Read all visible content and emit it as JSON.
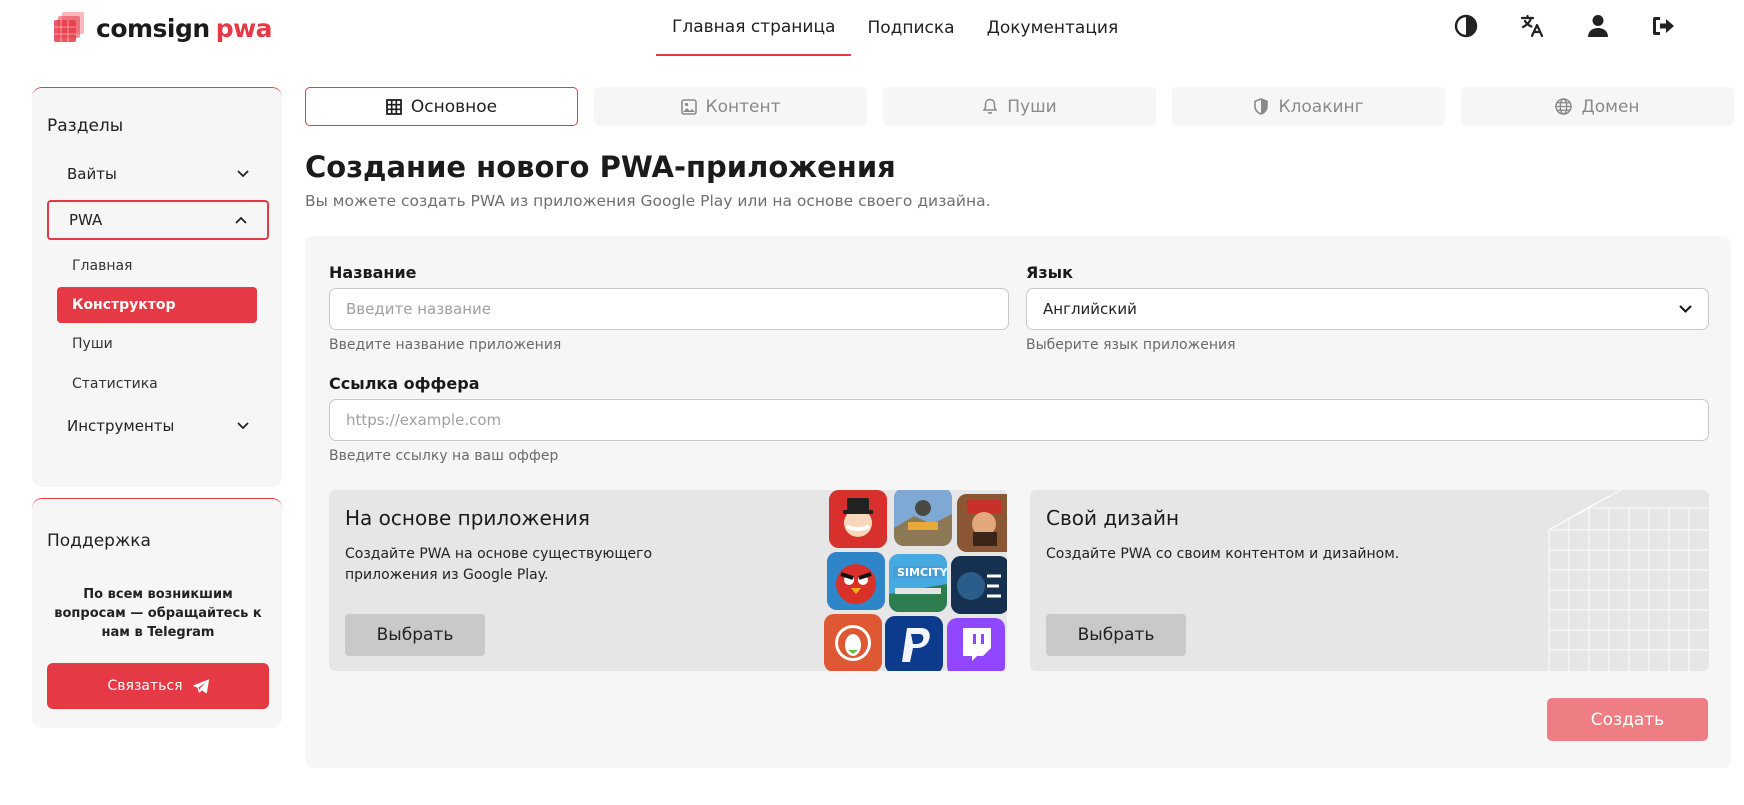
{
  "brand": {
    "name_part1": "comsign",
    "name_part2": "pwa",
    "accent": "#e63946"
  },
  "topnav": {
    "items": [
      {
        "label": "Главная страница",
        "active": true
      },
      {
        "label": "Подписка",
        "active": false
      },
      {
        "label": "Документация",
        "active": false
      }
    ]
  },
  "header_icons": [
    "contrast-icon",
    "translate-icon",
    "user-icon",
    "logout-icon"
  ],
  "sidebar": {
    "title": "Разделы",
    "items": [
      {
        "label": "Вайты",
        "icon": "chevron-down-icon"
      },
      {
        "label": "PWA",
        "icon": "chevron-up-icon",
        "open": true
      },
      {
        "label": "Инструменты",
        "icon": "chevron-down-icon"
      }
    ],
    "pwa_sub": [
      {
        "label": "Главная",
        "active": false
      },
      {
        "label": "Конструктор",
        "active": true
      },
      {
        "label": "Пуши",
        "active": false
      },
      {
        "label": "Статистика",
        "active": false
      }
    ]
  },
  "support": {
    "title": "Поддержка",
    "text": "По всем возникшим вопросам — обращайтесь к нам в Telegram",
    "button": "Связаться",
    "button_icon": "telegram-icon"
  },
  "tabs": [
    {
      "label": "Основное",
      "icon": "grid-icon",
      "active": true
    },
    {
      "label": "Контент",
      "icon": "image-icon",
      "active": false
    },
    {
      "label": "Пуши",
      "icon": "bell-icon",
      "active": false
    },
    {
      "label": "Клоакинг",
      "icon": "shield-icon",
      "active": false
    },
    {
      "label": "Домен",
      "icon": "globe-icon",
      "active": false
    }
  ],
  "page": {
    "title": "Создание нового PWA-приложения",
    "subtitle": "Вы можете создать PWA из приложения Google Play или на основе своего дизайна."
  },
  "form": {
    "name": {
      "label": "Название",
      "placeholder": "Введите название",
      "help": "Введите название приложения",
      "value": ""
    },
    "language": {
      "label": "Язык",
      "value": "Английский",
      "help": "Выберите язык приложения"
    },
    "offer": {
      "label": "Ссылка оффера",
      "placeholder": "https://example.com",
      "help": "Введите ссылку на ваш оффер",
      "value": ""
    }
  },
  "options": [
    {
      "title": "На основе приложения",
      "text": "Создайте PWA на основе существующего приложения из Google Play.",
      "button": "Выбрать"
    },
    {
      "title": "Свой дизайн",
      "text": "Создайте PWA со своим контентом и дизайном.",
      "button": "Выбрать"
    }
  ],
  "create_button": "Создать"
}
